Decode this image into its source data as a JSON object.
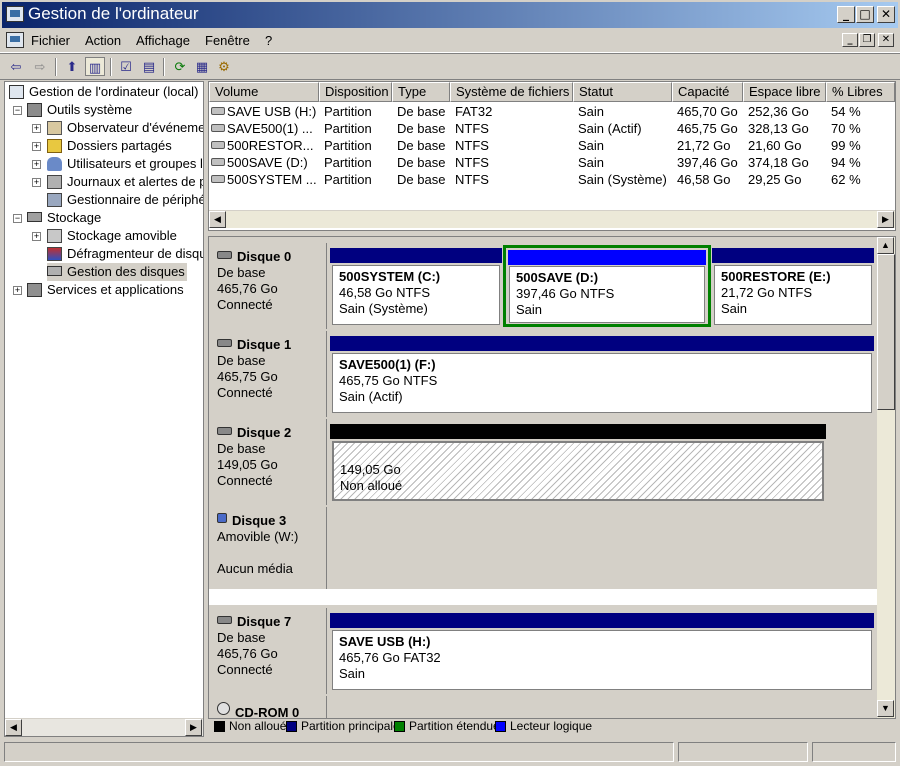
{
  "window": {
    "title": "Gestion de l'ordinateur",
    "min": "_",
    "max": "□",
    "close": "✕"
  },
  "menu": {
    "items": [
      "Fichier",
      "Action",
      "Affichage",
      "Fenêtre",
      "?"
    ],
    "mdi_min": "_",
    "mdi_restore": "❐",
    "mdi_close": "✕"
  },
  "tree": {
    "root": "Gestion de l'ordinateur (local)",
    "outils": "Outils système",
    "observateur": "Observateur d'événeme",
    "dossiers": "Dossiers partagés",
    "utilisateurs": "Utilisateurs et groupes l",
    "journaux": "Journaux et alertes de p",
    "gestionnaire": "Gestionnaire de périphé",
    "stockage": "Stockage",
    "amovible": "Stockage amovible",
    "defrag": "Défragmenteur de disqu",
    "gestion_disques": "Gestion des disques",
    "services": "Services et applications"
  },
  "volumes": {
    "headers": [
      "Volume",
      "Disposition",
      "Type",
      "Système de fichiers",
      "Statut",
      "Capacité",
      "Espace libre",
      "% Libres"
    ],
    "rows": [
      [
        "SAVE USB (H:)",
        "Partition",
        "De base",
        "FAT32",
        "Sain",
        "465,70 Go",
        "252,36 Go",
        "54 %"
      ],
      [
        "SAVE500(1) ...",
        "Partition",
        "De base",
        "NTFS",
        "Sain (Actif)",
        "465,75 Go",
        "328,13 Go",
        "70 %"
      ],
      [
        "500RESTOR...",
        "Partition",
        "De base",
        "NTFS",
        "Sain",
        "21,72 Go",
        "21,60 Go",
        "99 %"
      ],
      [
        "500SAVE (D:)",
        "Partition",
        "De base",
        "NTFS",
        "Sain",
        "397,46 Go",
        "374,18 Go",
        "94 %"
      ],
      [
        "500SYSTEM ...",
        "Partition",
        "De base",
        "NTFS",
        "Sain (Système)",
        "46,58 Go",
        "29,25 Go",
        "62 %"
      ]
    ]
  },
  "disks": {
    "d0": {
      "name": "Disque 0",
      "type": "De base",
      "size": "465,76 Go",
      "state": "Connecté",
      "v1": {
        "name": "500SYSTEM  (C:)",
        "size": "46,58 Go NTFS",
        "status": "Sain (Système)"
      },
      "v2": {
        "name": "500SAVE  (D:)",
        "size": "397,46 Go NTFS",
        "status": "Sain"
      },
      "v3": {
        "name": "500RESTORE  (E:)",
        "size": "21,72 Go NTFS",
        "status": "Sain"
      }
    },
    "d1": {
      "name": "Disque 1",
      "type": "De base",
      "size": "465,75 Go",
      "state": "Connecté",
      "v1": {
        "name": "SAVE500(1)  (F:)",
        "size": "465,75 Go NTFS",
        "status": "Sain (Actif)"
      }
    },
    "d2": {
      "name": "Disque 2",
      "type": "De base",
      "size": "149,05 Go",
      "state": "Connecté",
      "v1": {
        "size": "149,05 Go",
        "status": "Non alloué"
      }
    },
    "d3": {
      "name": "Disque 3",
      "type": "Amovible (W:)",
      "state": "Aucun média"
    },
    "d7": {
      "name": "Disque 7",
      "type": "De base",
      "size": "465,76 Go",
      "state": "Connecté",
      "v1": {
        "name": "SAVE USB  (H:)",
        "size": "465,76 Go FAT32",
        "status": "Sain"
      }
    },
    "cd": {
      "name": "CD-ROM 0"
    }
  },
  "legend": [
    "Non alloué",
    "Partition principale",
    "Partition étendue",
    "Lecteur logique"
  ],
  "colors": {
    "primary": "#000080",
    "logical": "#0000ff",
    "extended": "#008000",
    "unallocated": "#000000"
  }
}
